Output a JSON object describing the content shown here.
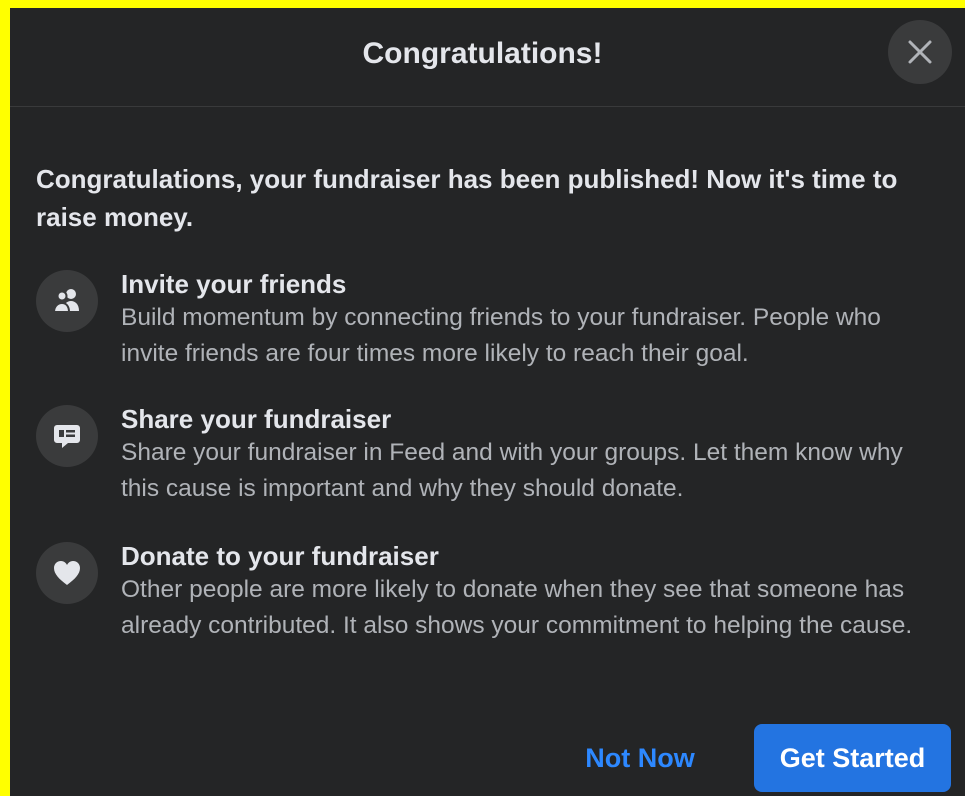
{
  "dialog": {
    "title": "Congratulations!",
    "close_icon": "close-icon",
    "intro": "Congratulations, your fundraiser has been published! Now it's time to raise money.",
    "items": [
      {
        "icon": "friends-icon",
        "title": "Invite your friends",
        "description": "Build momentum by connecting friends to your fundraiser. People who invite friends are four times more likely to reach their goal."
      },
      {
        "icon": "share-message-icon",
        "title": "Share your fundraiser",
        "description": "Share your fundraiser in Feed and with your groups. Let them know why this cause is important and why they should donate."
      },
      {
        "icon": "heart-icon",
        "title": "Donate to your fundraiser",
        "description": "Other people are more likely to donate when they see that someone has already contributed. It also shows your commitment to helping the cause."
      }
    ],
    "buttons": {
      "not_now": "Not Now",
      "get_started": "Get Started"
    }
  },
  "colors": {
    "frame": "#ffff00",
    "dialog_bg": "#242526",
    "primary_text": "#e4e6eb",
    "secondary_text": "#b0b3b8",
    "accent": "#2374e1",
    "link": "#2d88ff"
  }
}
